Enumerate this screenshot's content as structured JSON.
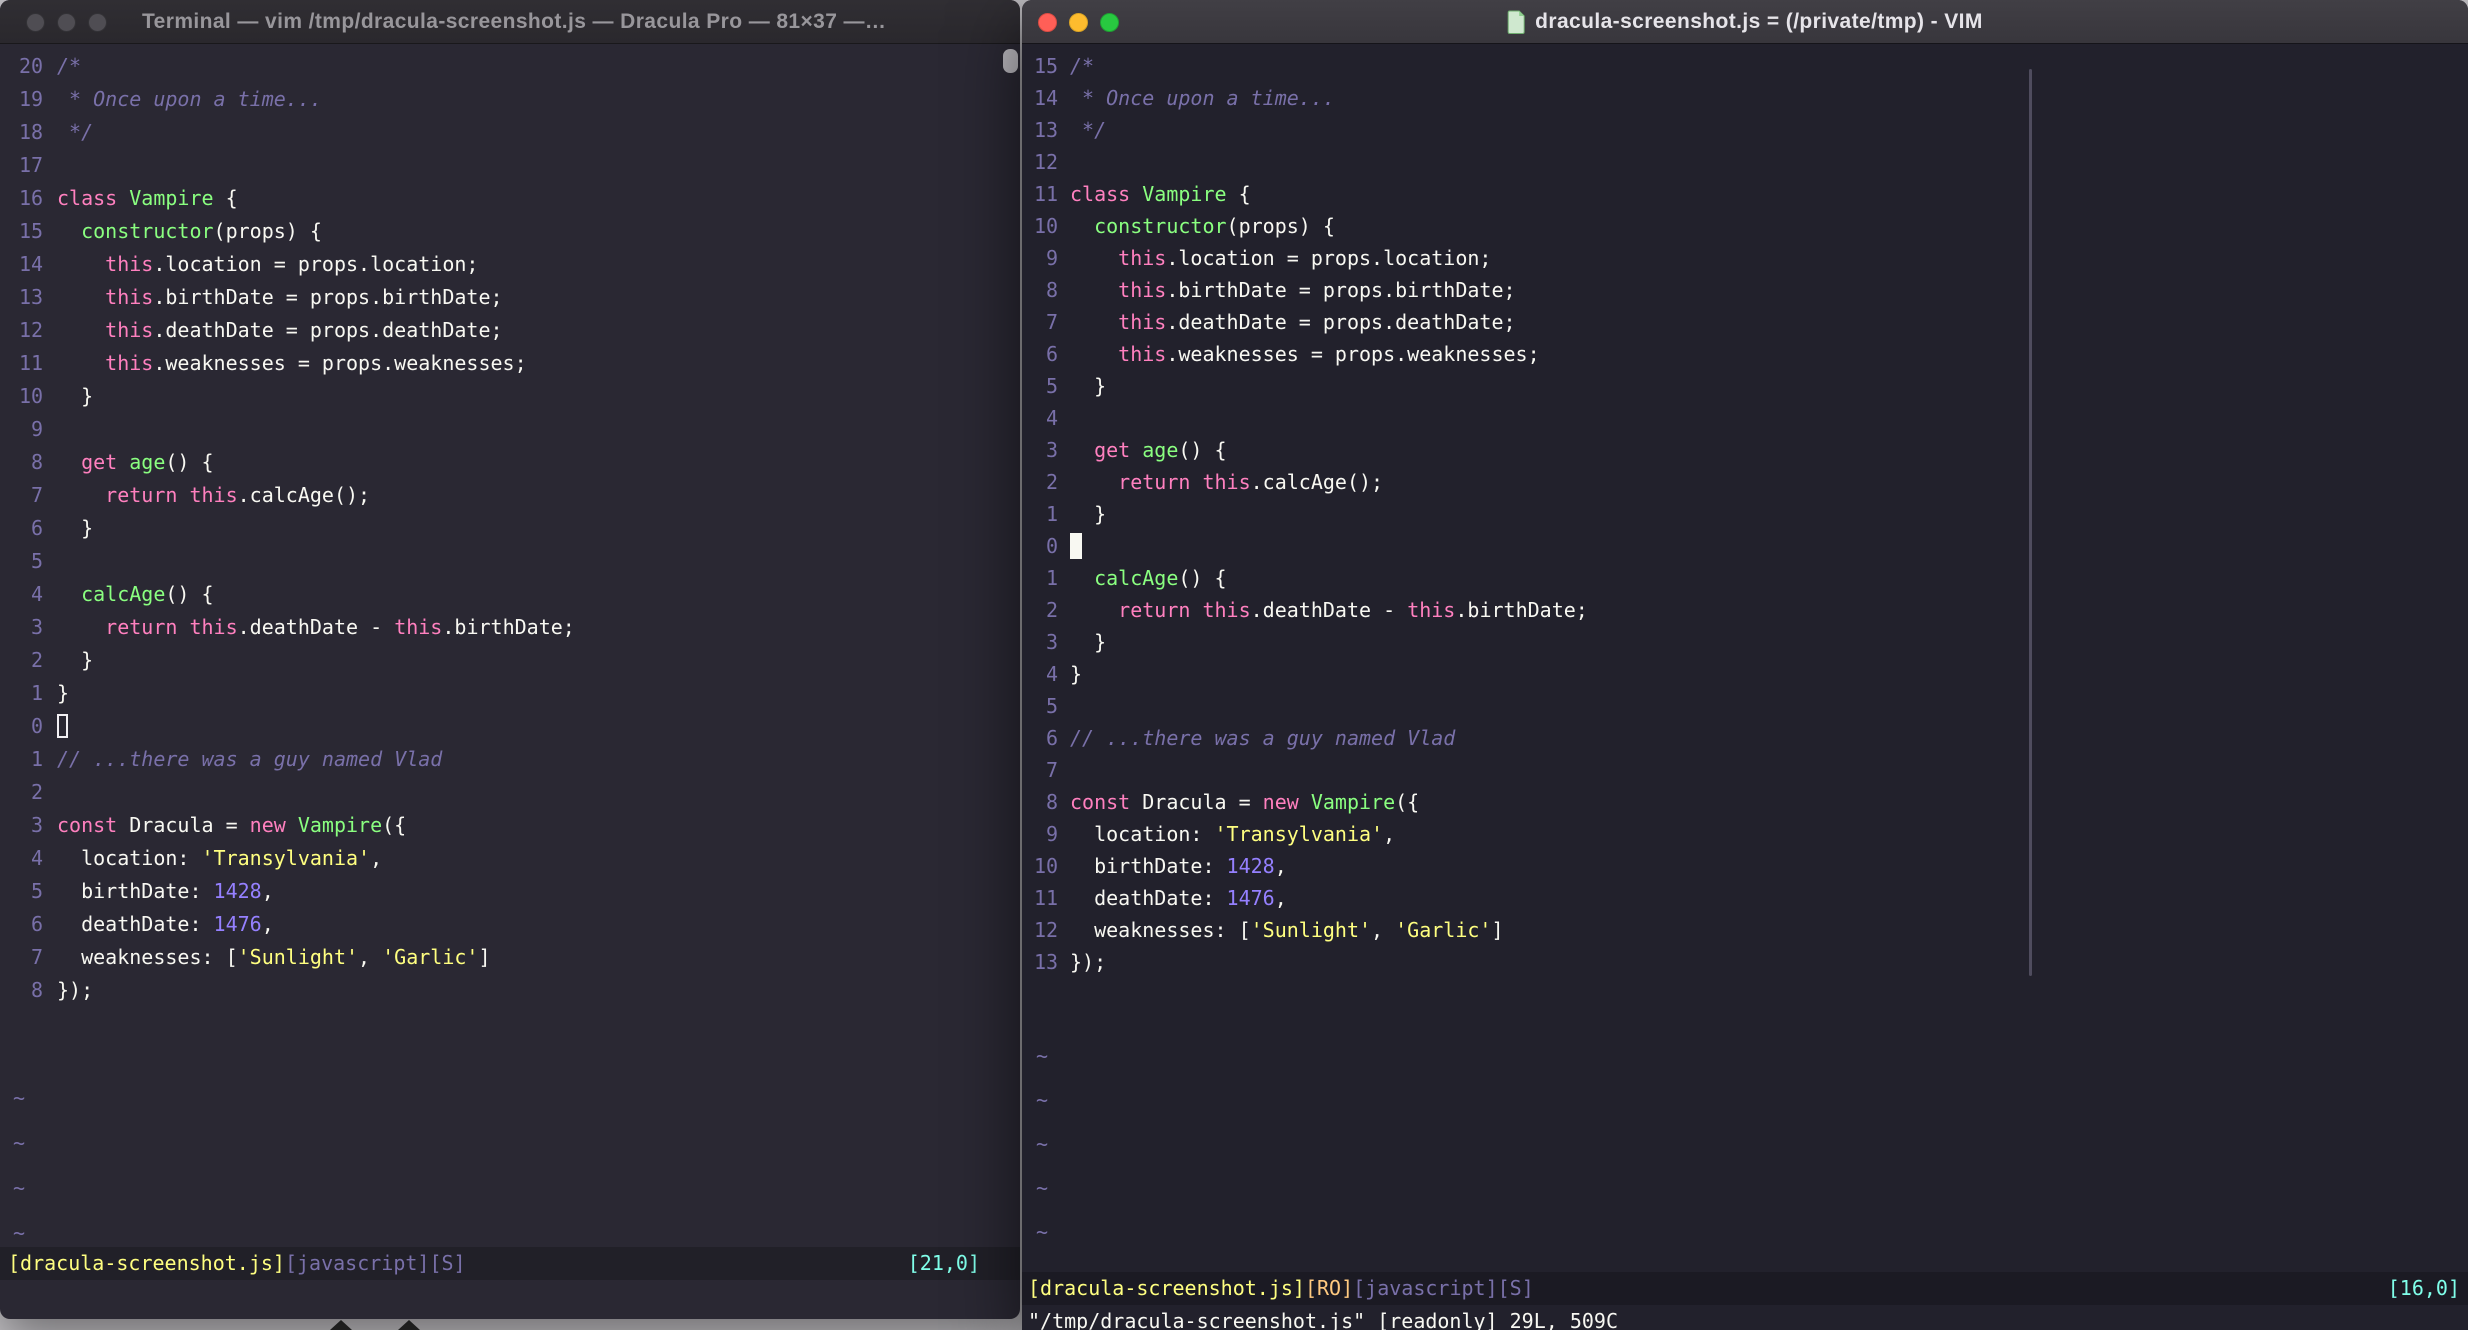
{
  "palette": {
    "background": "#22212c",
    "background_terminal": "#2a2833",
    "foreground": "#f8f8f2",
    "comment": "#7970a9",
    "pink": "#ff80bf",
    "green": "#8aff80",
    "yellow": "#ffff80",
    "purple": "#9580ff",
    "cyan": "#80ffea",
    "orange": "#ffca80",
    "traffic_red": "#ff5f57",
    "traffic_yellow": "#febc2e",
    "traffic_green": "#28c840"
  },
  "code": {
    "lines": [
      {
        "tokens": [
          [
            "c",
            "/*"
          ]
        ]
      },
      {
        "tokens": [
          [
            "c",
            " * Once upon a time..."
          ]
        ]
      },
      {
        "tokens": [
          [
            "c",
            " */"
          ]
        ]
      },
      {
        "tokens": []
      },
      {
        "tokens": [
          [
            "k",
            "class"
          ],
          [
            "w",
            " "
          ],
          [
            "f",
            "Vampire"
          ],
          [
            "w",
            " {"
          ]
        ]
      },
      {
        "tokens": [
          [
            "w",
            "  "
          ],
          [
            "f",
            "constructor"
          ],
          [
            "w",
            "(props) {"
          ]
        ]
      },
      {
        "tokens": [
          [
            "w",
            "    "
          ],
          [
            "k",
            "this"
          ],
          [
            "w",
            ".location = props.location;"
          ]
        ]
      },
      {
        "tokens": [
          [
            "w",
            "    "
          ],
          [
            "k",
            "this"
          ],
          [
            "w",
            ".birthDate = props.birthDate;"
          ]
        ]
      },
      {
        "tokens": [
          [
            "w",
            "    "
          ],
          [
            "k",
            "this"
          ],
          [
            "w",
            ".deathDate = props.deathDate;"
          ]
        ]
      },
      {
        "tokens": [
          [
            "w",
            "    "
          ],
          [
            "k",
            "this"
          ],
          [
            "w",
            ".weaknesses = props.weaknesses;"
          ]
        ]
      },
      {
        "tokens": [
          [
            "w",
            "  }"
          ]
        ]
      },
      {
        "tokens": []
      },
      {
        "tokens": [
          [
            "w",
            "  "
          ],
          [
            "k",
            "get"
          ],
          [
            "w",
            " "
          ],
          [
            "f",
            "age"
          ],
          [
            "w",
            "() {"
          ]
        ]
      },
      {
        "tokens": [
          [
            "w",
            "    "
          ],
          [
            "k",
            "return"
          ],
          [
            "w",
            " "
          ],
          [
            "k",
            "this"
          ],
          [
            "w",
            ".calcAge();"
          ]
        ]
      },
      {
        "tokens": [
          [
            "w",
            "  }"
          ]
        ]
      },
      {
        "tokens": []
      },
      {
        "tokens": [
          [
            "w",
            "  "
          ],
          [
            "f",
            "calcAge"
          ],
          [
            "w",
            "() {"
          ]
        ]
      },
      {
        "tokens": [
          [
            "w",
            "    "
          ],
          [
            "k",
            "return"
          ],
          [
            "w",
            " "
          ],
          [
            "k",
            "this"
          ],
          [
            "w",
            ".deathDate - "
          ],
          [
            "k",
            "this"
          ],
          [
            "w",
            ".birthDate;"
          ]
        ]
      },
      {
        "tokens": [
          [
            "w",
            "  }"
          ]
        ]
      },
      {
        "tokens": [
          [
            "w",
            "}"
          ]
        ]
      },
      {
        "tokens": []
      },
      {
        "tokens": [
          [
            "c",
            "// ...there was a guy named Vlad"
          ]
        ]
      },
      {
        "tokens": []
      },
      {
        "tokens": [
          [
            "k",
            "const"
          ],
          [
            "w",
            " Dracula = "
          ],
          [
            "k",
            "new"
          ],
          [
            "w",
            " "
          ],
          [
            "f",
            "Vampire"
          ],
          [
            "w",
            "({"
          ]
        ]
      },
      {
        "tokens": [
          [
            "w",
            "  location: "
          ],
          [
            "s",
            "'Transylvania'"
          ],
          [
            "w",
            ","
          ]
        ]
      },
      {
        "tokens": [
          [
            "w",
            "  birthDate: "
          ],
          [
            "n",
            "1428"
          ],
          [
            "w",
            ","
          ]
        ]
      },
      {
        "tokens": [
          [
            "w",
            "  deathDate: "
          ],
          [
            "n",
            "1476"
          ],
          [
            "w",
            ","
          ]
        ]
      },
      {
        "tokens": [
          [
            "w",
            "  weaknesses: ["
          ],
          [
            "s",
            "'Sunlight'"
          ],
          [
            "w",
            ", "
          ],
          [
            "s",
            "'Garlic'"
          ],
          [
            "w",
            "]"
          ]
        ]
      },
      {
        "tokens": [
          [
            "w",
            "});"
          ]
        ]
      }
    ]
  },
  "left_window": {
    "title": "Terminal — vim /tmp/dracula-screenshot.js — Dracula Pro — 81×37 —…",
    "numbers": [
      "20",
      "19",
      "18",
      "17",
      "16",
      "15",
      "14",
      "13",
      "12",
      "11",
      "10",
      "9",
      "8",
      "7",
      "6",
      "5",
      "4",
      "3",
      "2",
      "1",
      "0",
      "1",
      "2",
      "3",
      "4",
      "5",
      "6",
      "7",
      "8"
    ],
    "cursor_row": 20,
    "cursor_style": "hollow",
    "tildes": [
      "~",
      "~",
      "~",
      "~"
    ],
    "status_left": [
      {
        "text": "[dracula-screenshot.js]",
        "color": "y"
      },
      {
        "text": "[javascript]",
        "color": "cm"
      },
      {
        "text": "[S]",
        "color": "cm"
      }
    ],
    "status_right": {
      "text": "[21,0]",
      "color": "cy"
    },
    "cmdline": ""
  },
  "right_window": {
    "title": "dracula-screenshot.js = (/private/tmp) - VIM",
    "numbers": [
      "15",
      "14",
      "13",
      "12",
      "11",
      "10",
      "9",
      "8",
      "7",
      "6",
      "5",
      "4",
      "3",
      "2",
      "1",
      "0",
      "1",
      "2",
      "3",
      "4",
      "5",
      "6",
      "7",
      "8",
      "9",
      "10",
      "11",
      "12",
      "13"
    ],
    "cursor_row": 15,
    "cursor_style": "block",
    "tildes": [
      "~",
      "~",
      "~",
      "~",
      "~"
    ],
    "status_left": [
      {
        "text": "[dracula-screenshot.js]",
        "color": "y"
      },
      {
        "text": "[RO]",
        "color": "o"
      },
      {
        "text": "[javascript]",
        "color": "cm"
      },
      {
        "text": "[S]",
        "color": "cm"
      }
    ],
    "status_right": {
      "text": "[16,0]",
      "color": "cy"
    },
    "cmdline": "\"/tmp/dracula-screenshot.js\" [readonly] 29L, 509C"
  }
}
